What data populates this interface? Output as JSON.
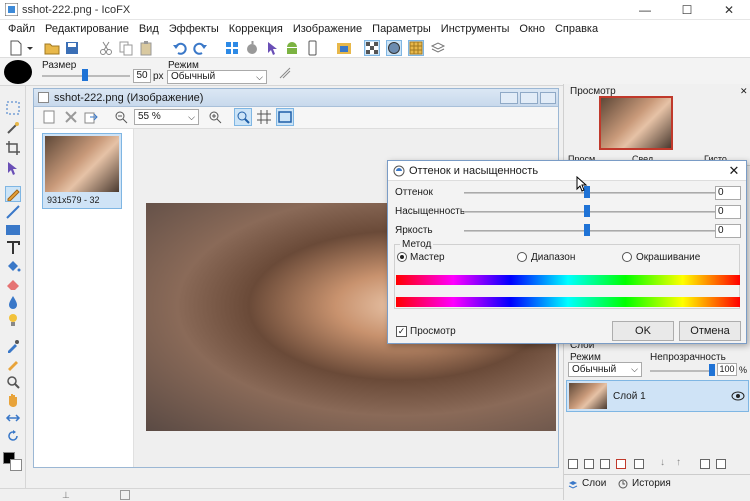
{
  "window": {
    "title": "sshot-222.png - IcoFX"
  },
  "menu": [
    "Файл",
    "Редактирование",
    "Вид",
    "Эффекты",
    "Коррекция",
    "Изображение",
    "Параметры",
    "Инструменты",
    "Окно",
    "Справка"
  ],
  "options": {
    "size_label": "Размер",
    "size_value": "50",
    "size_unit": "px",
    "mode_label": "Режим",
    "mode_value": "Обычный"
  },
  "document": {
    "title": "sshot-222.png (Изображение)",
    "zoom": "55 %",
    "thumb_caption": "931x579 - 32"
  },
  "preview_panel": {
    "title": "Просмотр",
    "tabs": [
      "Просм...",
      "Свед...",
      "Гисто..."
    ]
  },
  "layers_panel": {
    "title": "Слои",
    "mode_label": "Режим",
    "mode_value": "Обычный",
    "opacity_label": "Непрозрачность",
    "opacity_value": "100",
    "opacity_unit": "%",
    "layer_name": "Слой 1",
    "tab_layers": "Слои",
    "tab_history": "История"
  },
  "dialog": {
    "title": "Оттенок и насыщенность",
    "hue_label": "Оттенок",
    "hue_value": "0",
    "sat_label": "Насыщенность",
    "sat_value": "0",
    "light_label": "Яркость",
    "light_value": "0",
    "method_label": "Метод",
    "methods": [
      "Мастер",
      "Диапазон",
      "Окрашивание"
    ],
    "preview_label": "Просмотр",
    "ok_label": "OK",
    "cancel_label": "Отмена"
  },
  "colors": {
    "accent": "#1f73d6",
    "panel_bg": "#f0f0f0",
    "selection": "#cce4f7"
  }
}
